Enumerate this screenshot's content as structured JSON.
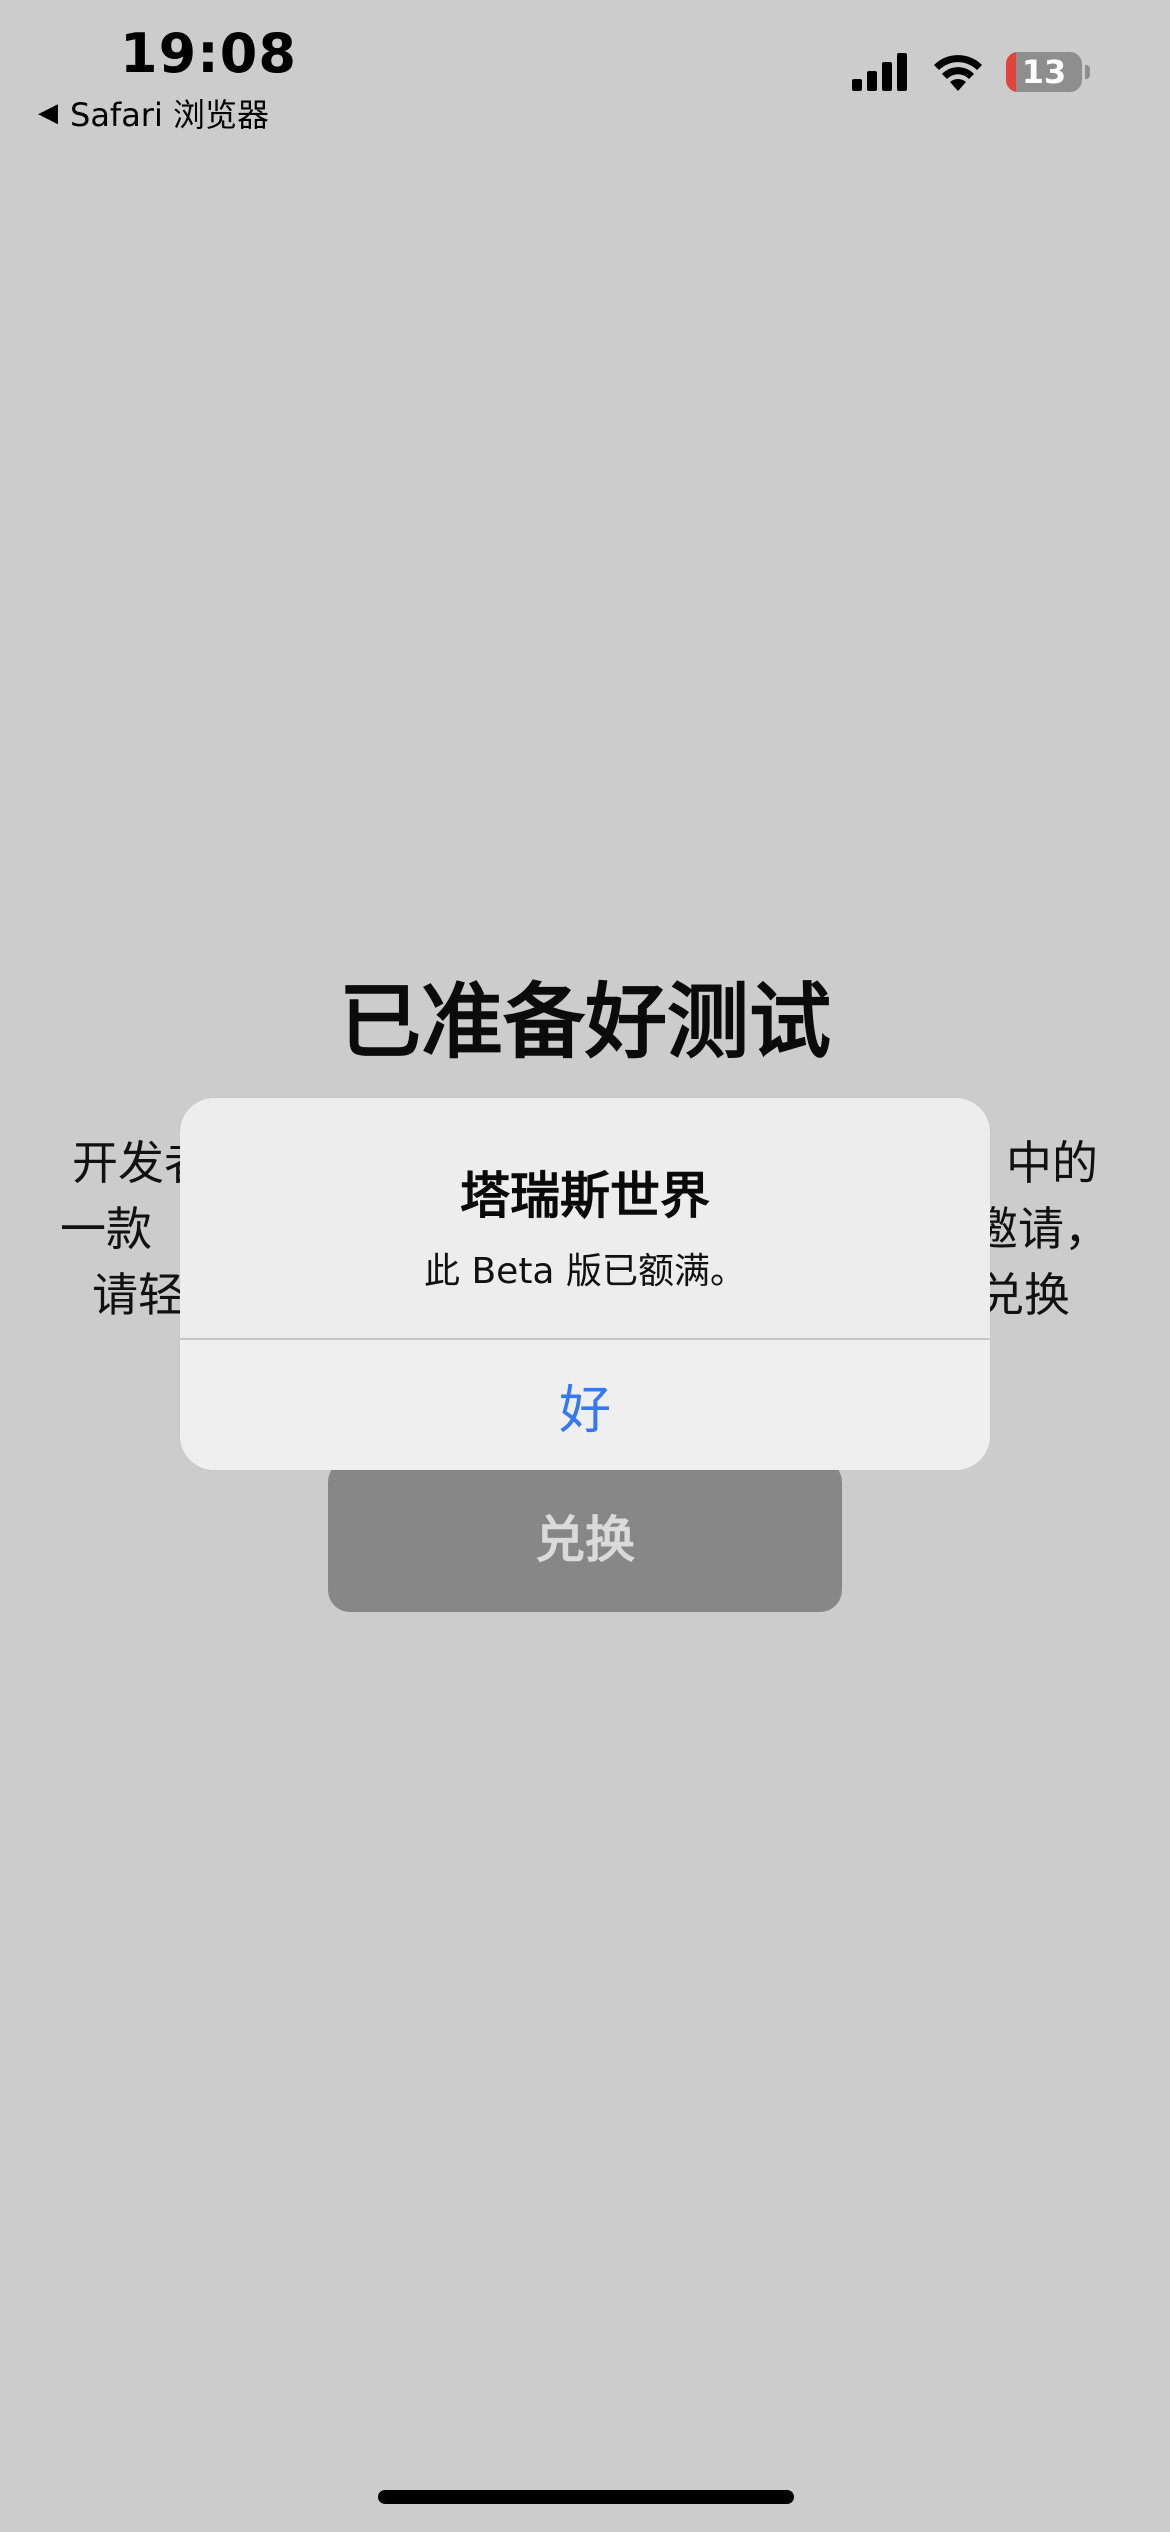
{
  "status_bar": {
    "time": "19:08",
    "back_app": "Safari 浏览器",
    "battery_level": "13",
    "battery_fraction": 0.13
  },
  "page": {
    "title": "已准备好测试",
    "description_lines": [
      "开发者",
      "中的",
      "一款",
      "邀请，",
      "请轻",
      "兑换"
    ],
    "redeem_label": "兑换"
  },
  "alert": {
    "title": "塔瑞斯世界",
    "message": "此 Beta 版已额满。",
    "ok_label": "好"
  },
  "colors": {
    "background": "#cccccc",
    "accent": "#3478f6",
    "battery_low": "#e0443b"
  }
}
